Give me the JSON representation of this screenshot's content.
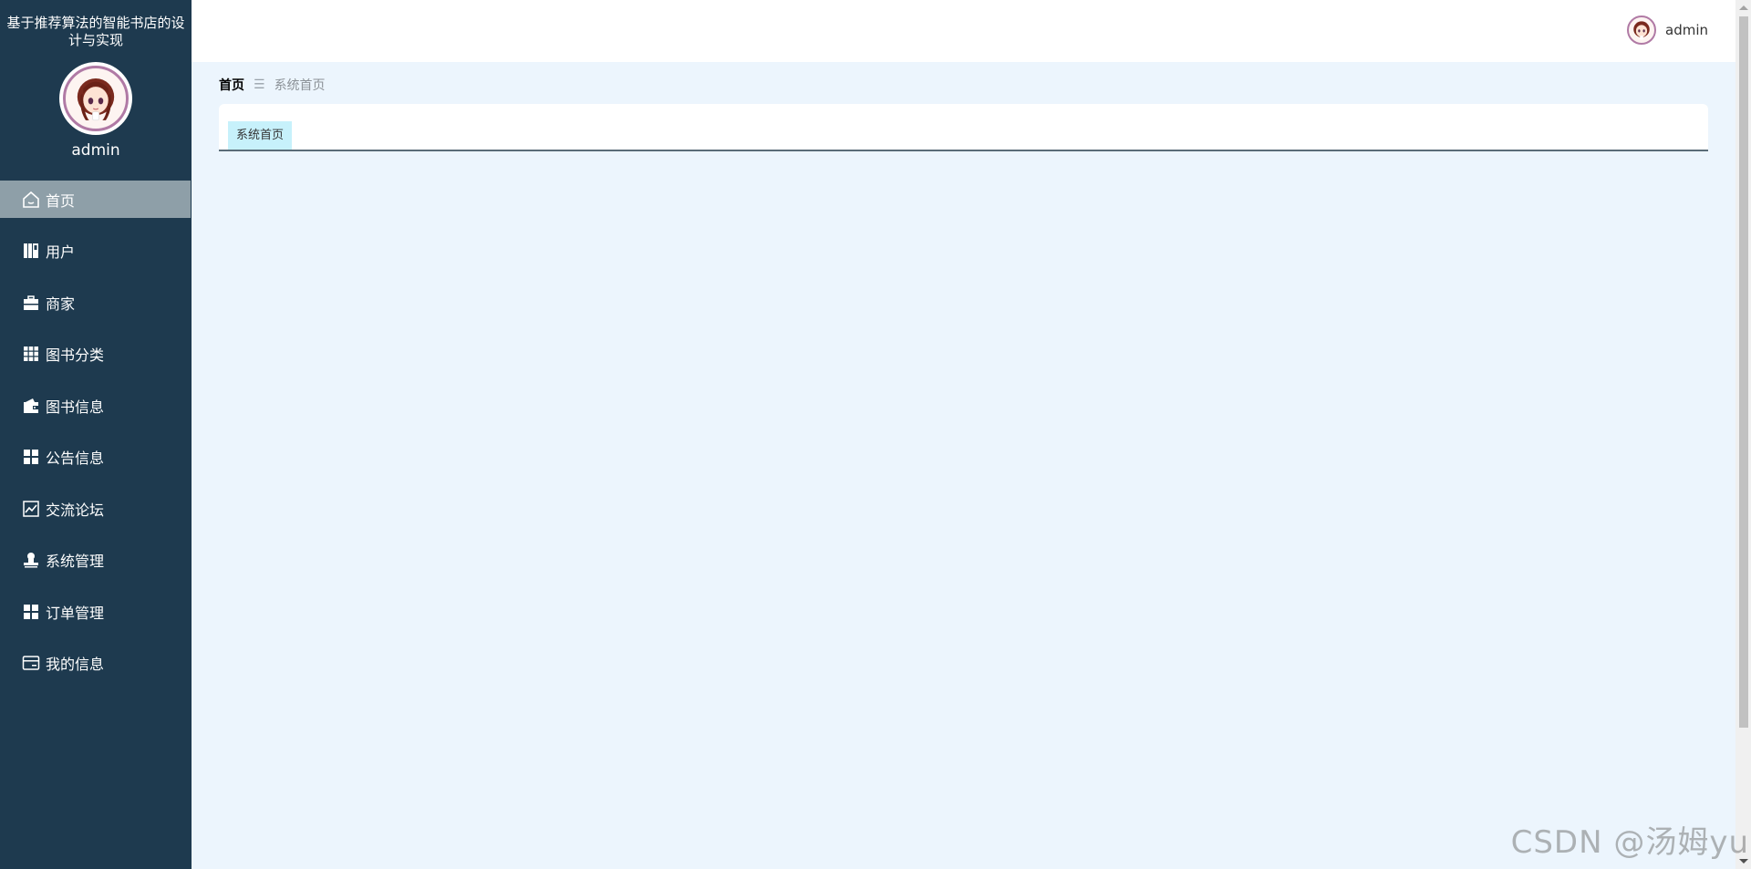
{
  "sidebar": {
    "system_title": "基于推荐算法的智能书店的设计与实现",
    "user_name": "admin",
    "menu": [
      {
        "label": "首页",
        "icon": "home-icon",
        "active": true
      },
      {
        "label": "用户",
        "icon": "book-icon",
        "active": false
      },
      {
        "label": "商家",
        "icon": "briefcase-icon",
        "active": false
      },
      {
        "label": "图书分类",
        "icon": "grid-icon",
        "active": false
      },
      {
        "label": "图书信息",
        "icon": "wallet-icon",
        "active": false
      },
      {
        "label": "公告信息",
        "icon": "dashboard-icon",
        "active": false
      },
      {
        "label": "交流论坛",
        "icon": "chart-icon",
        "active": false
      },
      {
        "label": "系统管理",
        "icon": "user-stamp-icon",
        "active": false
      },
      {
        "label": "订单管理",
        "icon": "dashboard-icon",
        "active": false
      },
      {
        "label": "我的信息",
        "icon": "card-icon",
        "active": false
      }
    ]
  },
  "topbar": {
    "user_name": "admin"
  },
  "breadcrumb": {
    "home": "首页",
    "separator": "☰",
    "current": "系统首页"
  },
  "tabs": [
    {
      "label": "系统首页",
      "active": true
    }
  ],
  "watermark": "CSDN @汤姆yu",
  "colors": {
    "sidebar_bg": "#1e3a4f",
    "menu_active_bg": "#8e9fa8",
    "content_bg": "#ecf5fd",
    "tab_bg": "#c7f1fb"
  }
}
